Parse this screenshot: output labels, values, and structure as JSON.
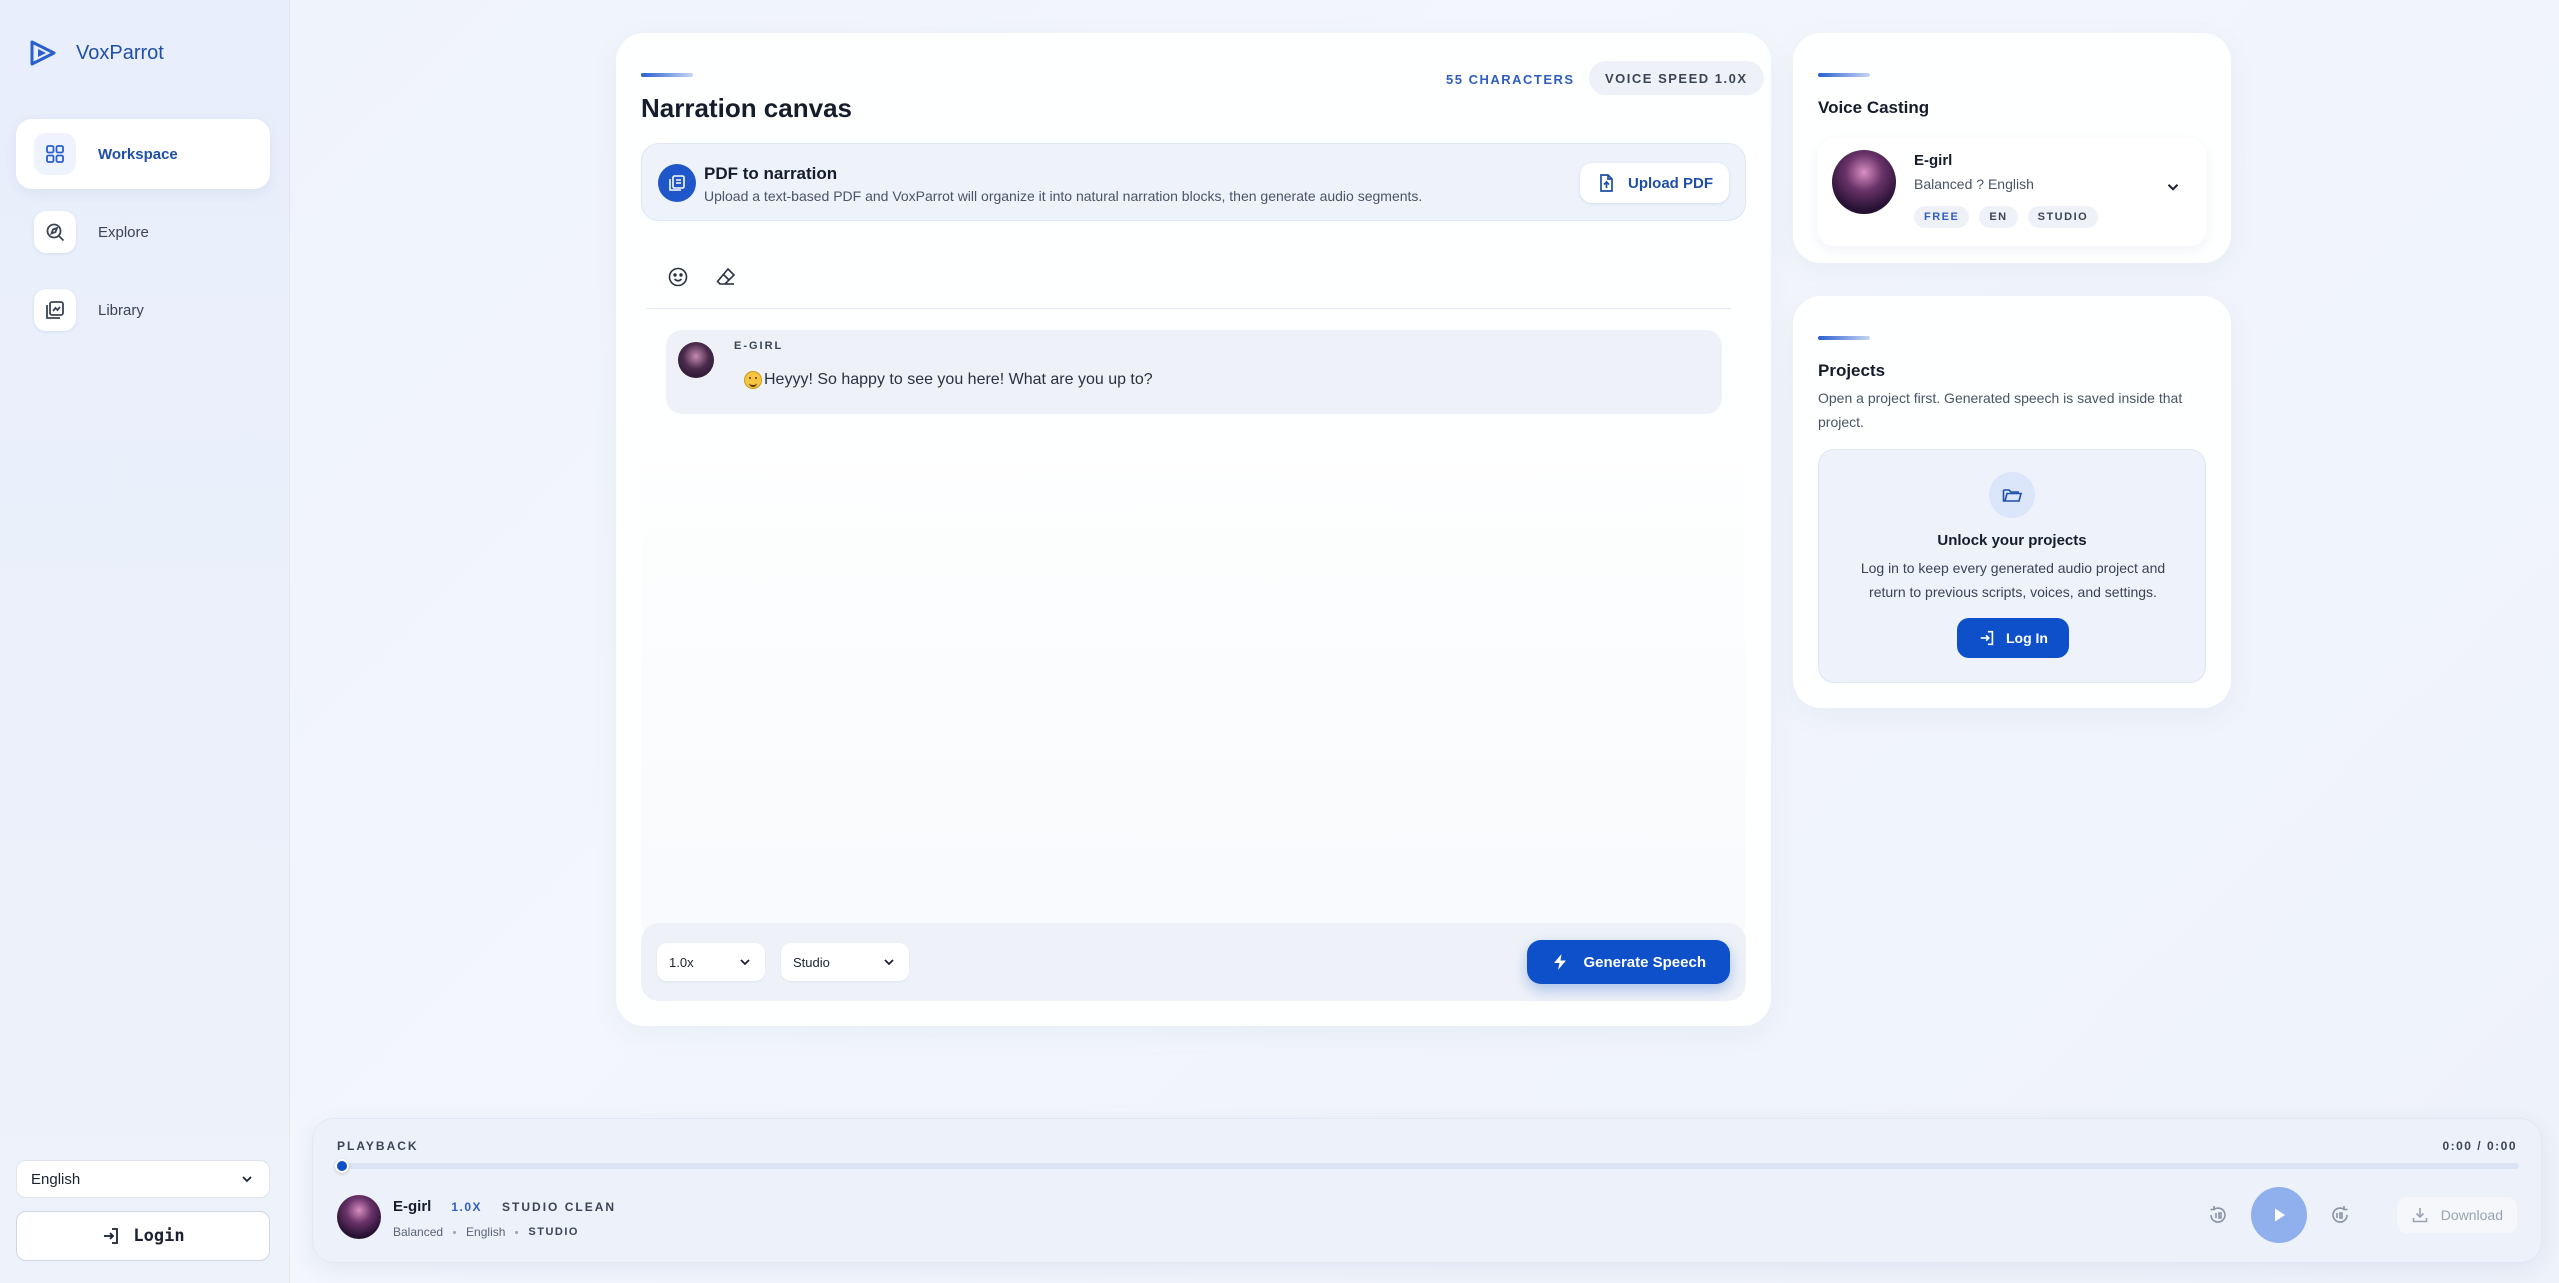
{
  "brand": {
    "name": "VoxParrot"
  },
  "sidebar": {
    "items": [
      {
        "label": "Workspace",
        "icon": "grid-icon",
        "active": true
      },
      {
        "label": "Explore",
        "icon": "explore-icon",
        "active": false
      },
      {
        "label": "Library",
        "icon": "library-icon",
        "active": false
      }
    ],
    "language": "English",
    "login_label": "Login"
  },
  "canvas": {
    "title": "Narration canvas",
    "characters": "55 CHARACTERS",
    "voice_speed": "VOICE SPEED 1.0X",
    "pdf": {
      "title": "PDF to narration",
      "description": "Upload a text-based PDF and VoxParrot will organize it into natural narration blocks, then generate audio segments.",
      "upload_label": "Upload PDF"
    },
    "segments": [
      {
        "speaker": "E-GIRL",
        "text": "Heyyy!  So happy to see you here! What are you up to?"
      }
    ],
    "speed_select": "1.0x",
    "quality_select": "Studio",
    "generate_label": "Generate Speech"
  },
  "voice_casting": {
    "title": "Voice Casting",
    "voice_name": "E-girl",
    "voice_meta": "Balanced ? English",
    "tags": [
      "FREE",
      "EN",
      "STUDIO"
    ]
  },
  "projects": {
    "title": "Projects",
    "description": "Open a project first. Generated speech is saved inside that project.",
    "unlock_title": "Unlock your projects",
    "unlock_description": "Log in to keep every generated audio project and return to previous scripts, voices, and settings.",
    "login_label": "Log In"
  },
  "playback": {
    "label": "PLAYBACK",
    "time": "0:00 / 0:00",
    "progress": 0,
    "voice": "E-girl",
    "speed": "1.0X",
    "mode": "STUDIO CLEAN",
    "meta_style": "Balanced",
    "meta_language": "English",
    "meta_quality": "STUDIO",
    "download_label": "Download"
  },
  "colors": {
    "accent": "#0d50c9",
    "brand_text": "#1f4fa8",
    "background": "#eef2fb"
  }
}
